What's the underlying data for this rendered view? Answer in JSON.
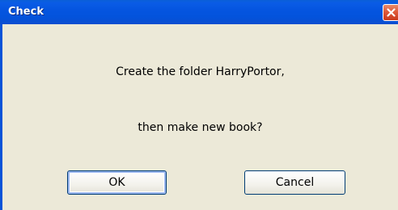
{
  "window": {
    "title": "Check"
  },
  "dialog": {
    "message_line1": "Create the folder HarryPortor,",
    "message_line2": "then make new book?"
  },
  "buttons": {
    "ok_label": "OK",
    "cancel_label": "Cancel"
  },
  "icons": {
    "close": "close-icon"
  },
  "colors": {
    "titlebar": "#0555e0",
    "close_button": "#e0593a",
    "dialog_background": "#ece9d8",
    "button_border": "#003c74"
  }
}
